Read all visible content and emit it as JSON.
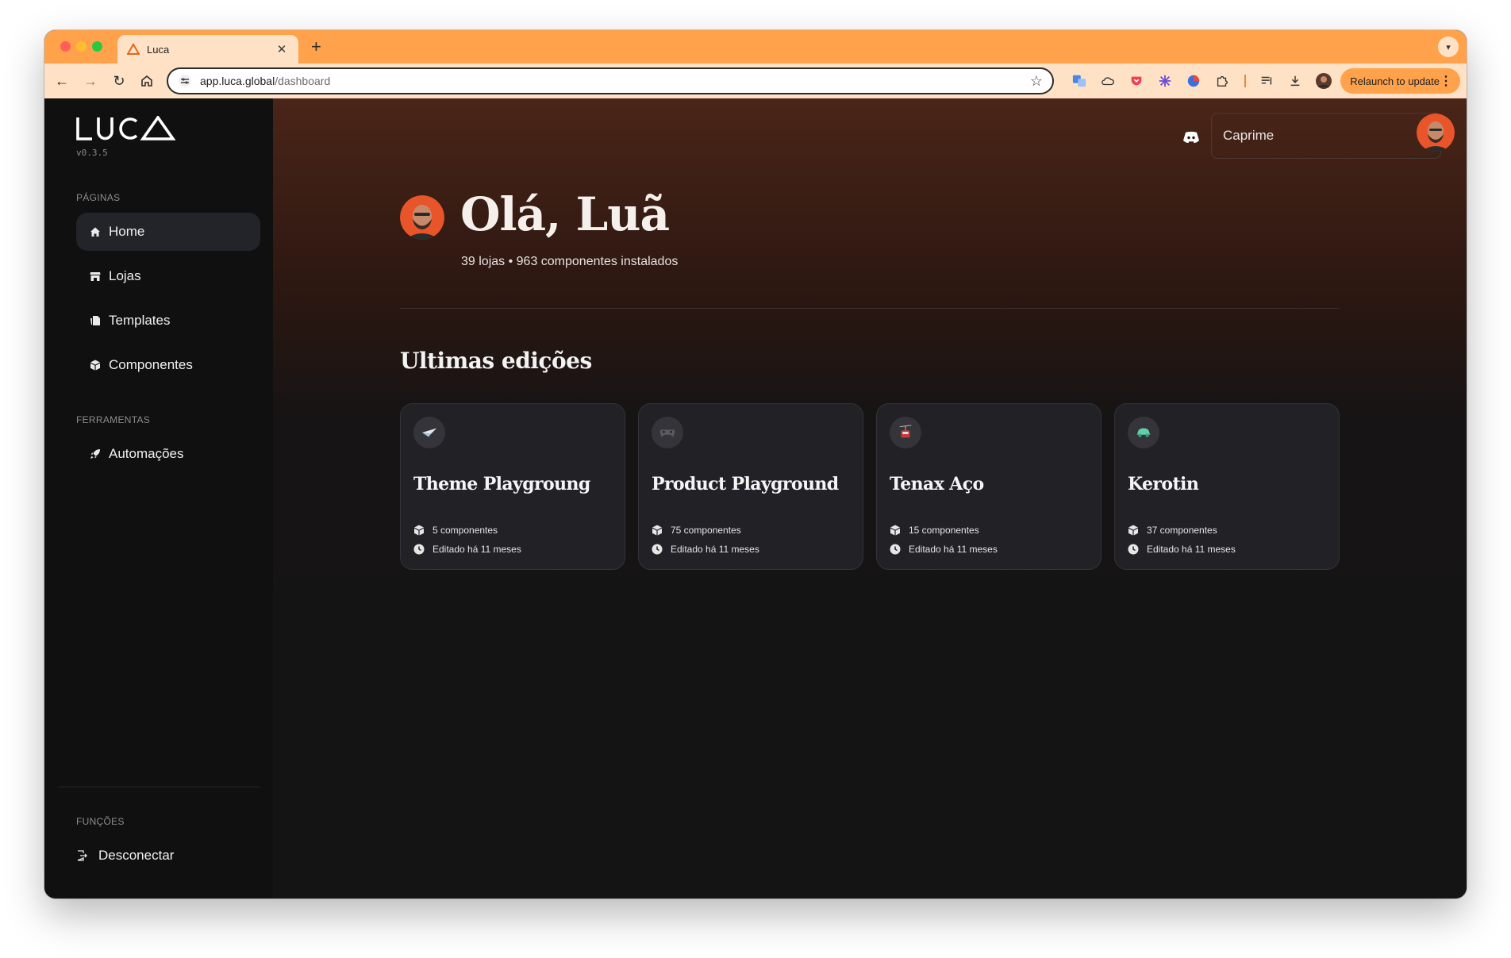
{
  "browser": {
    "tab_title": "Luca",
    "url_host": "app.luca.global",
    "url_path": "/dashboard",
    "relaunch_label": "Relaunch to update"
  },
  "sidebar": {
    "logo_text": "LUCA",
    "version": "v0.3.5",
    "section_pages": "PÁGINAS",
    "pages": [
      {
        "label": "Home",
        "icon": "home-icon",
        "active": true
      },
      {
        "label": "Lojas",
        "icon": "store-icon",
        "active": false
      },
      {
        "label": "Templates",
        "icon": "templates-icon",
        "active": false
      },
      {
        "label": "Componentes",
        "icon": "cube-icon",
        "active": false
      }
    ],
    "section_tools": "FERRAMENTAS",
    "tools": [
      {
        "label": "Automações",
        "icon": "rocket-icon"
      }
    ],
    "section_functions": "FUNÇÕES",
    "logout_label": "Desconectar"
  },
  "header": {
    "store_select_value": "Caprime"
  },
  "main": {
    "greeting": "Olá, Luã",
    "stats": "39 lojas • 963 componentes instalados",
    "recent_title": "Ultimas edições",
    "cards": [
      {
        "title": "Theme Playgroung",
        "components": "5 componentes",
        "edited": "Editado há 11 meses",
        "icon": "paper-plane-icon"
      },
      {
        "title": "Product Playground",
        "components": "75 componentes",
        "edited": "Editado há 11 meses",
        "icon": "gamepad-icon"
      },
      {
        "title": "Tenax Aço",
        "components": "15 componentes",
        "edited": "Editado há 11 meses",
        "icon": "tram-icon"
      },
      {
        "title": "Kerotin",
        "components": "37 componentes",
        "edited": "Editado há 11 meses",
        "icon": "car-icon"
      }
    ]
  },
  "colors": {
    "tab_accent": "#ffa24b",
    "toolbar_bg": "#ffe2c6",
    "sidebar_bg": "#101010",
    "main_gradient_top": "#4a2518",
    "card_bg": "#222126"
  }
}
